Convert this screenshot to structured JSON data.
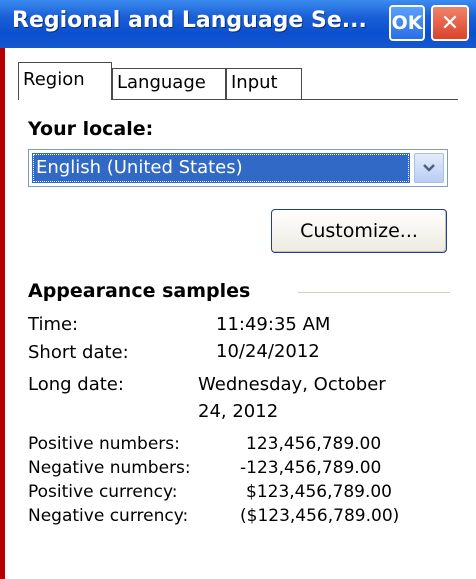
{
  "window": {
    "title": "Regional and Language Se...",
    "ok_label": "OK",
    "close_label": "✕"
  },
  "tabs": [
    {
      "label": "Region",
      "active": true
    },
    {
      "label": "Language",
      "active": false
    },
    {
      "label": "Input",
      "active": false
    }
  ],
  "locale": {
    "label": "Your locale:",
    "selected": "English (United States)",
    "customize_label": "Customize..."
  },
  "appearance": {
    "title": "Appearance samples",
    "time_label": "Time:",
    "time_value": "11:49:35 AM",
    "short_date_label": "Short date:",
    "short_date_value": "10/24/2012",
    "long_date_label": "Long date:",
    "long_date_value_line1": "Wednesday, October",
    "long_date_value_line2": "24, 2012",
    "positive_numbers_label": "Positive numbers:",
    "positive_numbers_value": "123,456,789.00",
    "negative_numbers_label": "Negative numbers:",
    "negative_numbers_value": "-123,456,789.00",
    "positive_currency_label": "Positive currency:",
    "positive_currency_value": "$123,456,789.00",
    "negative_currency_label": "Negative currency:",
    "negative_currency_value": "($123,456,789.00)"
  },
  "colors": {
    "titlebar": "#0b4fcf",
    "selection": "#3169c6",
    "window_edge": "#b40000"
  }
}
